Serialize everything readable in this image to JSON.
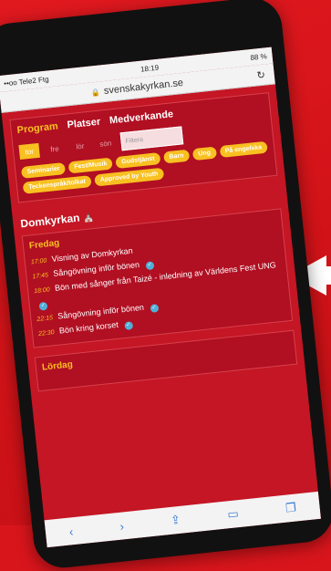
{
  "status": {
    "carrier": "••oo Tele2 Ftg",
    "time": "18:19",
    "battery": "88 %"
  },
  "url": "svenskakyrkan.se",
  "nav": [
    "Program",
    "Platser",
    "Medverkande"
  ],
  "days": [
    "sön",
    "lör",
    "fre",
    "tor"
  ],
  "active_day_index": 3,
  "filter_placeholder": "Filtera",
  "tags": [
    "Seminarier",
    "Fest/Musik",
    "Gudstjänst",
    "Barn",
    "Ung",
    "På engelska",
    "Teckenspråk/tolkat",
    "Approved by Youth"
  ],
  "church": "Domkyrkan",
  "schedule": {
    "day": "Fredag",
    "events": [
      {
        "time": "17:00",
        "title": "Visning av Domkyrkan",
        "check": false
      },
      {
        "time": "17:45",
        "title": "Sångövning inför bönen",
        "check": true
      },
      {
        "time": "18:00",
        "title": "Bön med sånger från Taizé - inledning av Världens Fest UNG",
        "check": true
      },
      {
        "time": "22:15",
        "title": "Sångövning inför bönen",
        "check": true
      },
      {
        "time": "22:30",
        "title": "Bön kring korset",
        "check": true
      }
    ]
  },
  "next_day": "Lördag",
  "colors": {
    "brand_red": "#d9151c",
    "accent_yellow": "#f8c021",
    "panel": "#b10f22"
  }
}
